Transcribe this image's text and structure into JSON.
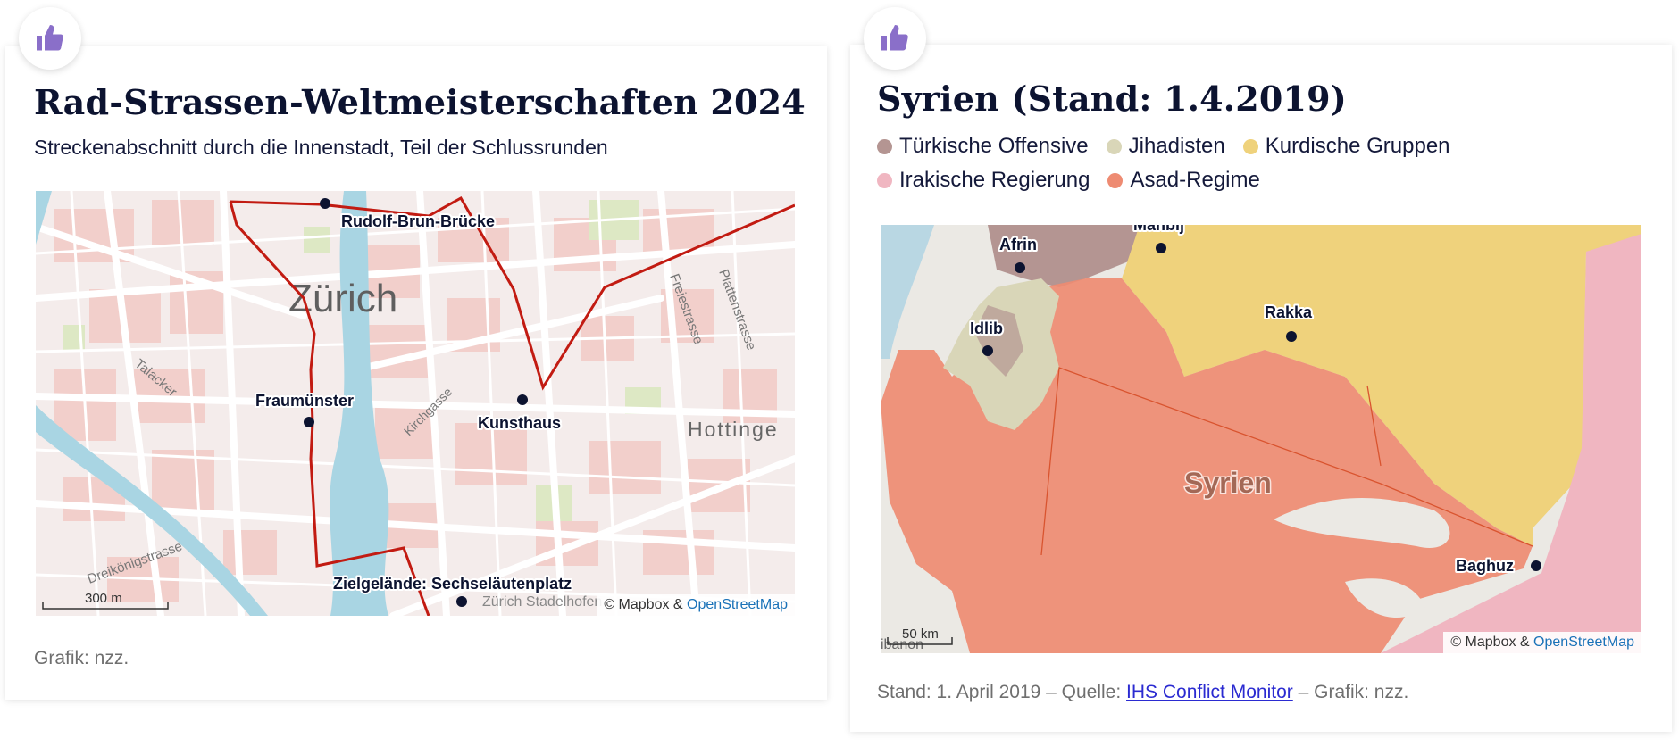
{
  "left_card": {
    "title": "Rad-Strassen-Weltmeisterschaften 2024",
    "subtitle": "Streckenabschnitt durch die Innenstadt, Teil der Schlussrunden",
    "map": {
      "city_label": "Zürich",
      "district_label": "Hottinge",
      "street_labels": [
        "Talacker",
        "Freiestrasse",
        "Plattenstrasse",
        "Kirchgasse",
        "Dreikönigstrasse"
      ],
      "station_label": "Zürich Stadelhofen",
      "places": [
        "Rudolf-Brun-Brücke",
        "Fraumünster",
        "Kunsthaus",
        "Zielgelände: Sechseläutenplatz"
      ],
      "scale": "300 m",
      "credit_mapbox": "© Mapbox",
      "credit_amp": "&",
      "credit_osm": "OpenStreetMap",
      "route_color": "#c21b12"
    },
    "footer": "Grafik: nzz."
  },
  "right_card": {
    "title": "Syrien (Stand: 1.4.2019)",
    "legend": [
      {
        "label": "Türkische Offensive",
        "color": "#b49592"
      },
      {
        "label": "Jihadisten",
        "color": "#d9d6b8"
      },
      {
        "label": "Kurdische Gruppen",
        "color": "#efd27c"
      },
      {
        "label": "Irakische Regierung",
        "color": "#f0b6c1"
      },
      {
        "label": "Asad-Regime",
        "color": "#ee8b72"
      }
    ],
    "map": {
      "country_label": "Syrien",
      "places": [
        "Manbij",
        "Afrin",
        "Rakka",
        "Idlib",
        "Baghuz"
      ],
      "edge_label": "ibanon",
      "scale": "50 km",
      "credit_mapbox": "© Mapbox",
      "credit_amp": "&",
      "credit_osm": "OpenStreetMap"
    },
    "footer_prefix": "Stand: 1. April 2019 – Quelle:",
    "footer_link": "IHS Conflict Monitor",
    "footer_suffix": " – Grafik: nzz."
  },
  "icons": {
    "like": "thumbs-up-icon",
    "like_color": "#8a6fc9"
  }
}
